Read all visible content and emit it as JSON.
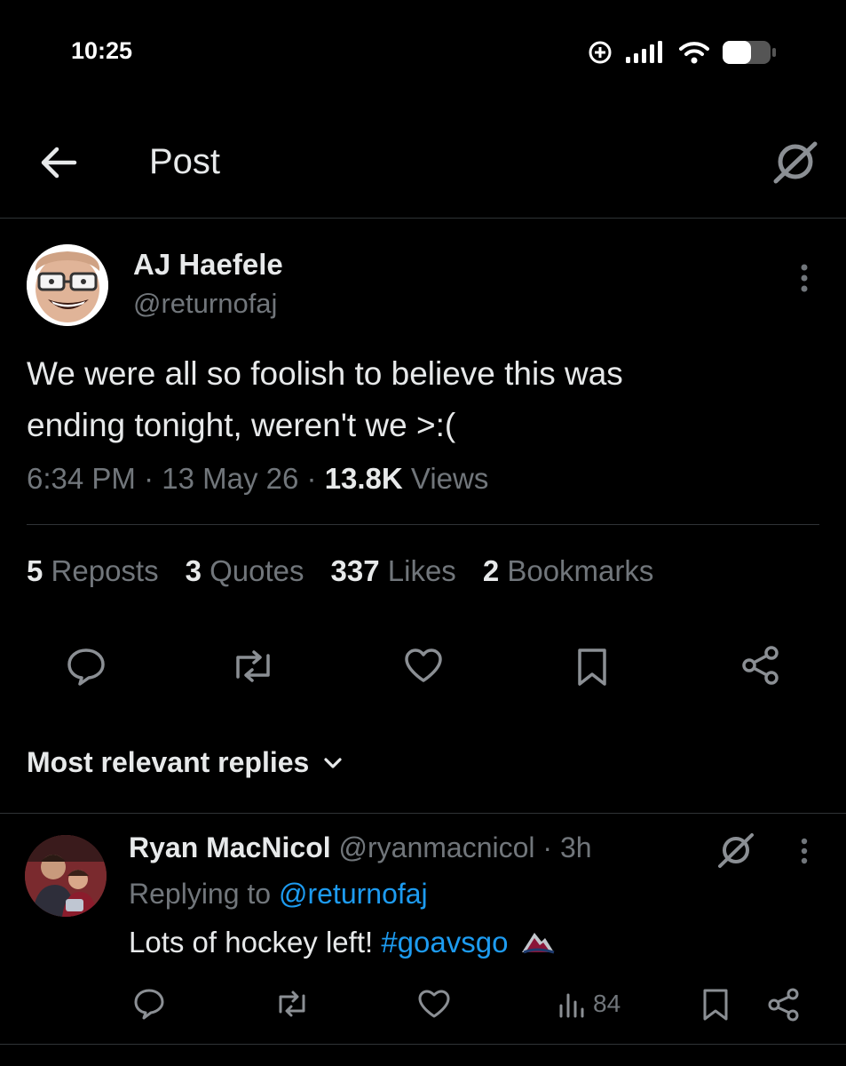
{
  "status_bar": {
    "time": "10:25"
  },
  "header": {
    "title": "Post"
  },
  "post": {
    "author_name": "AJ Haefele",
    "author_handle": "@returnofaj",
    "text_line1": "We were all so foolish to believe this was",
    "text_line2": "ending tonight, weren't we >:(",
    "time": "6:34 PM",
    "sep1": "·",
    "date": "13 May 26",
    "sep2": "·",
    "views_count": "13.8K",
    "views_label": "Views",
    "stats": {
      "reposts_count": "5",
      "reposts_label": "Reposts",
      "quotes_count": "3",
      "quotes_label": "Quotes",
      "likes_count": "337",
      "likes_label": "Likes",
      "bookmarks_count": "2",
      "bookmarks_label": "Bookmarks"
    }
  },
  "replies_filter": {
    "label": "Most relevant replies"
  },
  "reply": {
    "author_name": "Ryan MacNicol",
    "author_handle": "@ryanmacnicol",
    "sep": "·",
    "age": "3h",
    "replying_prefix": "Replying to",
    "replying_handle": "@returnofaj",
    "text": "Lots of hockey left!",
    "hashtag": "#goavsgo",
    "views": "84"
  },
  "icons": {
    "back": "arrow-left-icon",
    "grok": "grok-icon",
    "more": "more-vertical-icon",
    "reply": "reply-icon",
    "repost": "repost-icon",
    "like": "heart-icon",
    "bookmark": "bookmark-icon",
    "share": "share-icon",
    "views": "views-icon",
    "chevron": "chevron-down-icon"
  },
  "colors": {
    "background": "#000000",
    "text": "#e7e9ea",
    "muted": "#71767b",
    "link": "#1d9bf0",
    "divider": "#2f3336"
  }
}
